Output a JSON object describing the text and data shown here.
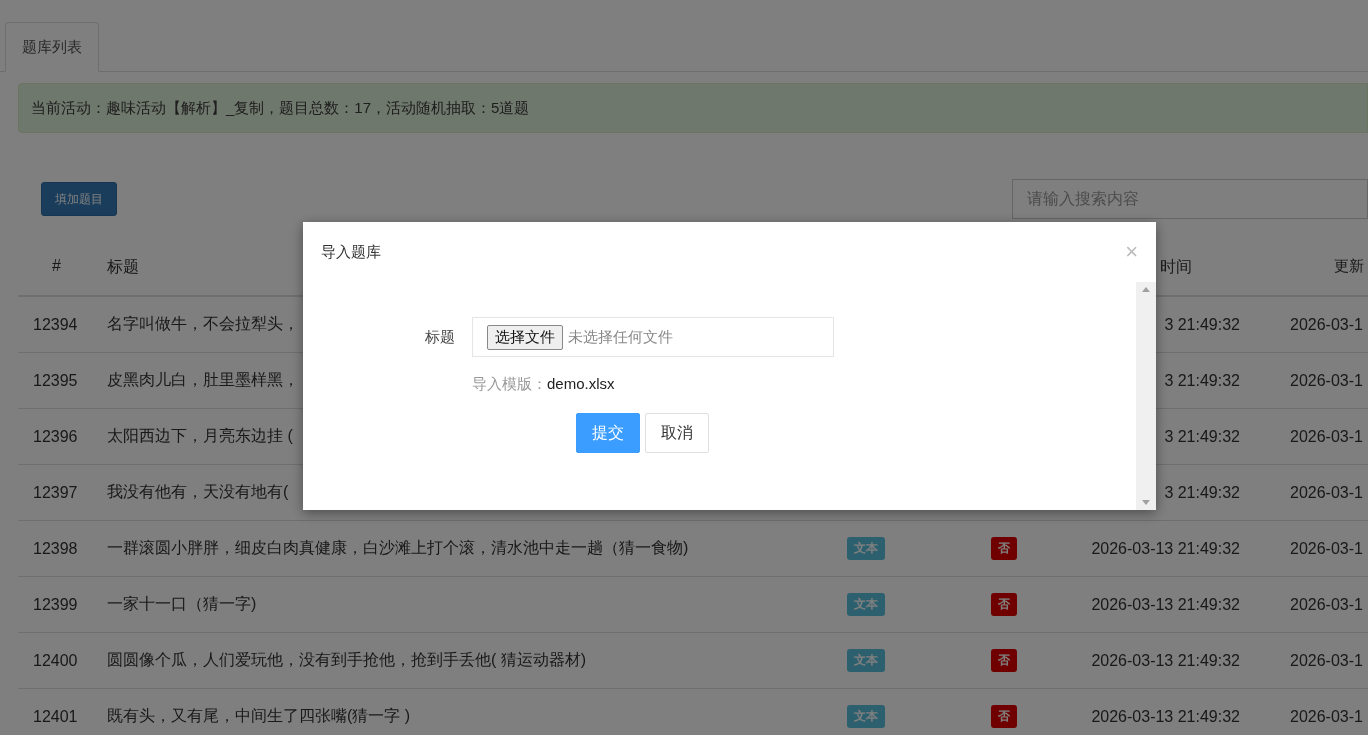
{
  "tabs": [
    {
      "label": "题库列表",
      "selected": true
    }
  ],
  "notice": "当前活动：趣味活动【解析】_复制，题目总数：17，活动随机抽取：5道题",
  "add_button": "填加题目",
  "search": {
    "placeholder": "请输入搜索内容"
  },
  "table": {
    "columns": [
      "#",
      "标题",
      "时间",
      "更新"
    ],
    "rows": [
      {
        "id": "12394",
        "title": "名字叫做牛，不会拉犁头，",
        "created": "3 21:49:32",
        "updated": "2026-03-1"
      },
      {
        "id": "12395",
        "title": "皮黑肉儿白，肚里墨样黑，",
        "created": "3 21:49:32",
        "updated": "2026-03-1"
      },
      {
        "id": "12396",
        "title": "太阳西边下，月亮东边挂 (",
        "created": "3 21:49:32",
        "updated": "2026-03-1"
      },
      {
        "id": "12397",
        "title": "我没有他有，天没有地有(",
        "created": "3 21:49:32",
        "updated": "2026-03-1"
      },
      {
        "id": "12398",
        "title": "一群滚圆小胖胖，细皮白肉真健康，白沙滩上打个滚，清水池中走一趟（猜一食物)",
        "type": "文本",
        "flag": "否",
        "created": "2026-03-13 21:49:32",
        "updated": "2026-03-1"
      },
      {
        "id": "12399",
        "title": "一家十一口（猜一字)",
        "type": "文本",
        "flag": "否",
        "created": "2026-03-13 21:49:32",
        "updated": "2026-03-1"
      },
      {
        "id": "12400",
        "title": "圆圆像个瓜，人们爱玩他，没有到手抢他，抢到手丢他( 猜运动器材)",
        "type": "文本",
        "flag": "否",
        "created": "2026-03-13 21:49:32",
        "updated": "2026-03-1"
      },
      {
        "id": "12401",
        "title": "既有头，又有尾，中间生了四张嘴(猜一字 )",
        "type": "文本",
        "flag": "否",
        "created": "2026-03-13 21:49:32",
        "updated": "2026-03-1"
      }
    ]
  },
  "modal": {
    "title": "导入题库",
    "close": "×",
    "field": {
      "label": "标题",
      "button": "选择文件",
      "status": "未选择任何文件"
    },
    "template": {
      "label": "导入模版：",
      "file": "demo.xlsx"
    },
    "buttons": [
      {
        "label": "提交",
        "kind": "primary"
      },
      {
        "label": "取消",
        "kind": "default"
      }
    ]
  }
}
